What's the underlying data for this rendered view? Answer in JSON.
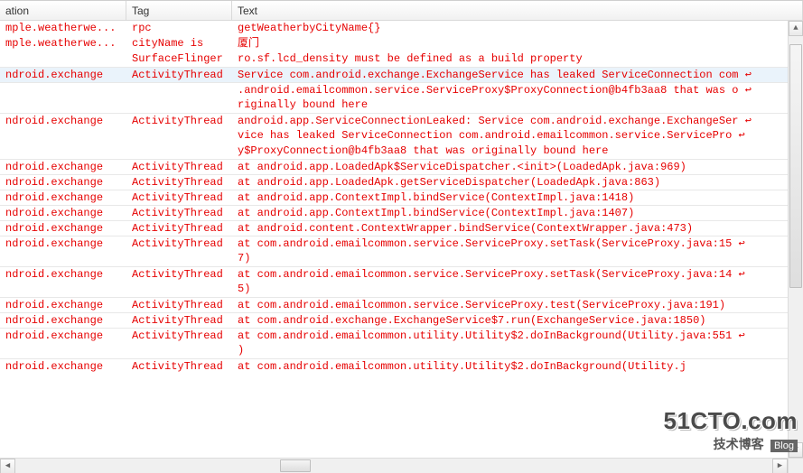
{
  "headers": {
    "application": "ation",
    "tag": "Tag",
    "text": "Text"
  },
  "rows": [
    {
      "app": "mple.weatherwe...",
      "tag": "rpc",
      "text": "getWeatherbyCityName{}",
      "selected": false,
      "sep": false
    },
    {
      "app": "mple.weatherwe...",
      "tag": "cityName is",
      "text": "厦门",
      "selected": false,
      "sep": false
    },
    {
      "app": "",
      "tag": "SurfaceFlinger",
      "text": "ro.sf.lcd_density must be defined as a build property",
      "selected": false,
      "sep": false
    },
    {
      "app": "ndroid.exchange",
      "tag": "ActivityThread",
      "text": "Service com.android.exchange.ExchangeService has leaked ServiceConnection com ↩",
      "selected": true,
      "sep": true
    },
    {
      "app": "",
      "tag": "",
      "text": ".android.emailcommon.service.ServiceProxy$ProxyConnection@b4fb3aa8 that was o ↩",
      "selected": false,
      "sep": true
    },
    {
      "app": "",
      "tag": "",
      "text": "riginally bound here",
      "selected": false,
      "sep": false
    },
    {
      "app": "ndroid.exchange",
      "tag": "ActivityThread",
      "text": "android.app.ServiceConnectionLeaked: Service com.android.exchange.ExchangeSer ↩",
      "selected": false,
      "sep": true
    },
    {
      "app": "",
      "tag": "",
      "text": "vice has leaked ServiceConnection com.android.emailcommon.service.ServicePro ↩",
      "selected": false,
      "sep": false
    },
    {
      "app": "",
      "tag": "",
      "text": "y$ProxyConnection@b4fb3aa8 that was originally bound here",
      "selected": false,
      "sep": false
    },
    {
      "app": "ndroid.exchange",
      "tag": "ActivityThread",
      "text": "at android.app.LoadedApk$ServiceDispatcher.<init>(LoadedApk.java:969)",
      "selected": false,
      "sep": true
    },
    {
      "app": "ndroid.exchange",
      "tag": "ActivityThread",
      "text": "at android.app.LoadedApk.getServiceDispatcher(LoadedApk.java:863)",
      "selected": false,
      "sep": true
    },
    {
      "app": "ndroid.exchange",
      "tag": "ActivityThread",
      "text": "at android.app.ContextImpl.bindService(ContextImpl.java:1418)",
      "selected": false,
      "sep": true
    },
    {
      "app": "ndroid.exchange",
      "tag": "ActivityThread",
      "text": "at android.app.ContextImpl.bindService(ContextImpl.java:1407)",
      "selected": false,
      "sep": true
    },
    {
      "app": "ndroid.exchange",
      "tag": "ActivityThread",
      "text": "at android.content.ContextWrapper.bindService(ContextWrapper.java:473)",
      "selected": false,
      "sep": true
    },
    {
      "app": "ndroid.exchange",
      "tag": "ActivityThread",
      "text": "at com.android.emailcommon.service.ServiceProxy.setTask(ServiceProxy.java:15 ↩",
      "selected": false,
      "sep": true
    },
    {
      "app": "",
      "tag": "",
      "text": "7)",
      "selected": false,
      "sep": false
    },
    {
      "app": "ndroid.exchange",
      "tag": "ActivityThread",
      "text": "at com.android.emailcommon.service.ServiceProxy.setTask(ServiceProxy.java:14 ↩",
      "selected": false,
      "sep": true
    },
    {
      "app": "",
      "tag": "",
      "text": "5)",
      "selected": false,
      "sep": false
    },
    {
      "app": "ndroid.exchange",
      "tag": "ActivityThread",
      "text": "at com.android.emailcommon.service.ServiceProxy.test(ServiceProxy.java:191)",
      "selected": false,
      "sep": true
    },
    {
      "app": "ndroid.exchange",
      "tag": "ActivityThread",
      "text": "at com.android.exchange.ExchangeService$7.run(ExchangeService.java:1850)",
      "selected": false,
      "sep": true
    },
    {
      "app": "ndroid.exchange",
      "tag": "ActivityThread",
      "text": "at com.android.emailcommon.utility.Utility$2.doInBackground(Utility.java:551 ↩",
      "selected": false,
      "sep": true
    },
    {
      "app": "",
      "tag": "",
      "text": ")",
      "selected": false,
      "sep": false
    },
    {
      "app": "ndroid.exchange",
      "tag": "ActivityThread",
      "text": "at com.android.emailcommon.utility.Utility$2.doInBackground(Utility.j",
      "selected": false,
      "sep": true
    }
  ],
  "vscroll": {
    "thumb_top_pct": 2,
    "thumb_height_pct": 60
  },
  "hscroll": {
    "thumb_left_pct": 35,
    "thumb_width_pct": 4
  },
  "watermark": {
    "big": "51CTO.com",
    "sub": "技术博客",
    "badge": "Blog"
  }
}
